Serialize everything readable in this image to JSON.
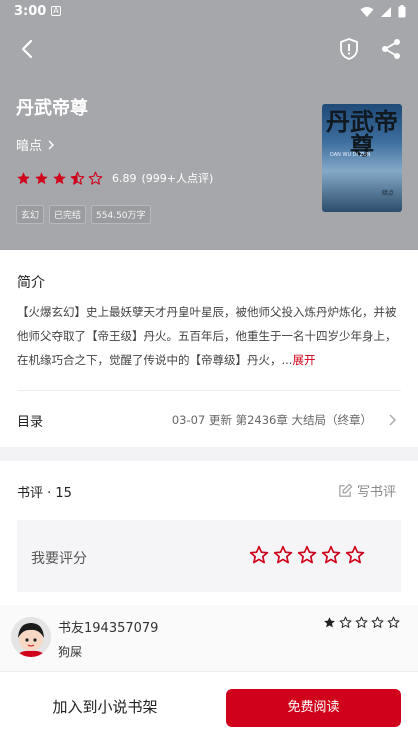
{
  "status": {
    "time": "3:00"
  },
  "book": {
    "title": "丹武帝尊",
    "author": "暗点",
    "score": "6.89",
    "rating_count": "(999+人点评)",
    "rating_stars": 3.5,
    "tags": [
      "玄幻",
      "已完结",
      "554.50万字"
    ],
    "cover_title": "丹武帝尊",
    "cover_sub": "DAN WU DI ZUN",
    "cover_author": "暗点"
  },
  "intro": {
    "heading": "简介",
    "text": "【火爆玄幻】史上最妖孽天才丹皇叶星辰，被他师父投入炼丹炉炼化，并被他师父夺取了【帝王级】丹火。五百年后，他重生于一名十四岁少年身上，在机缘巧合之下，觉醒了传说中的【帝尊级】丹火，...",
    "more": "展开"
  },
  "toc": {
    "label": "目录",
    "latest": "03-07  更新  第2436章 大结局（终章）"
  },
  "reviews": {
    "heading": "书评 · 15",
    "write_label": "写书评",
    "my_rating_label": "我要评分",
    "items": [
      {
        "user": "书友194357079",
        "text": "狗屎",
        "stars": 1
      }
    ]
  },
  "bottom": {
    "add_shelf": "加入到小说书架",
    "read_free": "免费阅读"
  },
  "colors": {
    "accent": "#d0021b",
    "header_bg": "#a5a7ab"
  }
}
